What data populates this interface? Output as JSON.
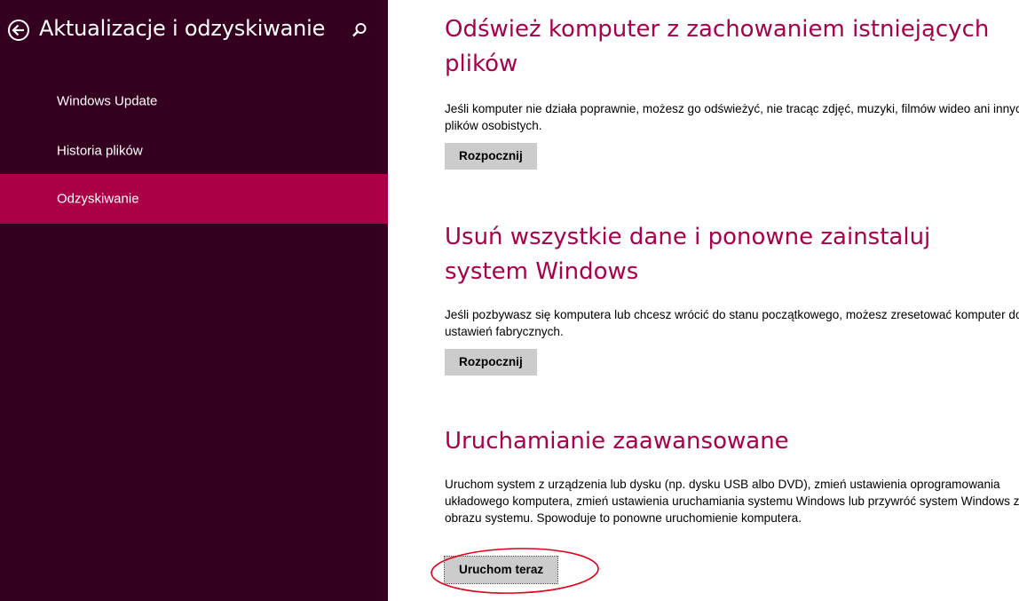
{
  "header": {
    "title": "Aktualizacje i odzyskiwanie",
    "back_icon": "back-arrow-circle-icon",
    "search_icon": "search-icon"
  },
  "sidebar": {
    "items": [
      {
        "label": "Windows Update",
        "selected": false
      },
      {
        "label": "Historia plików",
        "selected": false
      },
      {
        "label": "Odzyskiwanie",
        "selected": true
      }
    ]
  },
  "sections": [
    {
      "title": "Odśwież komputer z zachowaniem istniejących plików",
      "description": "Jeśli komputer nie działa poprawnie, możesz go odświeżyć, nie tracąc zdjęć, muzyki, filmów wideo ani innych plików osobistych.",
      "button": "Rozpocznij"
    },
    {
      "title": "Usuń wszystkie dane i ponowne zainstaluj system Windows",
      "description": "Jeśli pozbywasz się komputera lub chcesz wrócić do stanu początkowego, możesz zresetować komputer do ustawień fabrycznych.",
      "button": "Rozpocznij"
    },
    {
      "title": "Uruchamianie zaawansowane",
      "description": "Uruchom system z urządzenia lub dysku (np. dysku USB albo DVD), zmień ustawienia oprogramowania układowego komputera, zmień ustawienia uruchamiania systemu Windows lub przywróć system Windows z obrazu systemu. Spowoduje to ponowne uruchomienie komputera.",
      "button": "Uruchom teraz"
    }
  ],
  "colors": {
    "sidebar_bg": "#35001f",
    "accent": "#ab0046",
    "title_color": "#a8004a",
    "button_bg": "#cccccc",
    "annotation": "#e0001a"
  }
}
